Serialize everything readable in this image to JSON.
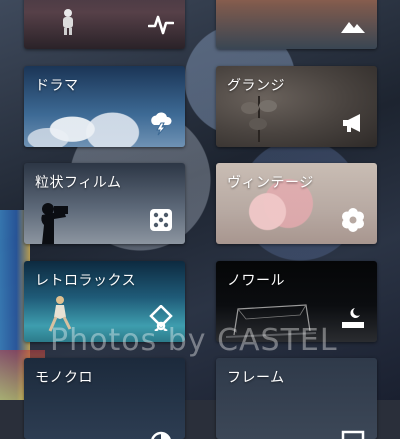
{
  "filters": [
    {
      "id": "top_left",
      "label": "",
      "icon": "activity-icon"
    },
    {
      "id": "top_right",
      "label": "",
      "icon": "mountain-icon"
    },
    {
      "id": "drama",
      "label": "ドラマ",
      "icon": "storm-cloud-icon"
    },
    {
      "id": "grunge",
      "label": "グランジ",
      "icon": "megaphone-icon"
    },
    {
      "id": "grain",
      "label": "粒状フィルム",
      "icon": "dice-icon"
    },
    {
      "id": "vintage",
      "label": "ヴィンテージ",
      "icon": "flower-icon"
    },
    {
      "id": "retro",
      "label": "レトロラックス",
      "icon": "location-pin-icon"
    },
    {
      "id": "noir",
      "label": "ノワール",
      "icon": "night-scene-icon"
    },
    {
      "id": "mono",
      "label": "モノクロ",
      "icon": "monochrome-icon"
    },
    {
      "id": "frame",
      "label": "フレーム",
      "icon": "frame-icon"
    }
  ],
  "watermark": "Photos by CASTEL"
}
